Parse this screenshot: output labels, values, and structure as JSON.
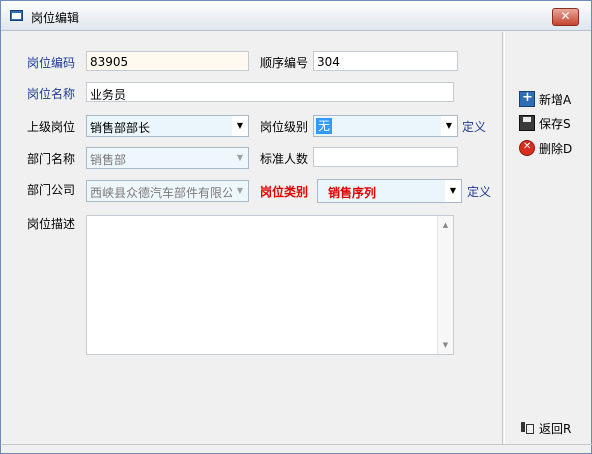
{
  "window": {
    "title": "岗位编辑",
    "close_label": "✕"
  },
  "form": {
    "post_code_label": "岗位编码",
    "post_code_value": "83905",
    "order_no_label": "顺序编号",
    "order_no_value": "304",
    "post_name_label": "岗位名称",
    "post_name_value": "业务员",
    "parent_post_label": "上级岗位",
    "parent_post_value": "销售部部长",
    "post_level_label": "岗位级别",
    "post_level_value": "无",
    "post_level_define": "定义",
    "dept_name_label": "部门名称",
    "dept_name_value": "销售部",
    "headcount_label": "标准人数",
    "headcount_value": "",
    "dept_company_label": "部门公司",
    "dept_company_value": "西峡县众德汽车部件有限公",
    "post_type_label": "岗位类别",
    "post_type_value": "销售序列",
    "post_type_define": "定义",
    "desc_label": "岗位描述",
    "desc_value": ""
  },
  "actions": {
    "new_label": "新增A",
    "save_label": "保存S",
    "delete_label": "删除D",
    "back_label": "返回R"
  }
}
